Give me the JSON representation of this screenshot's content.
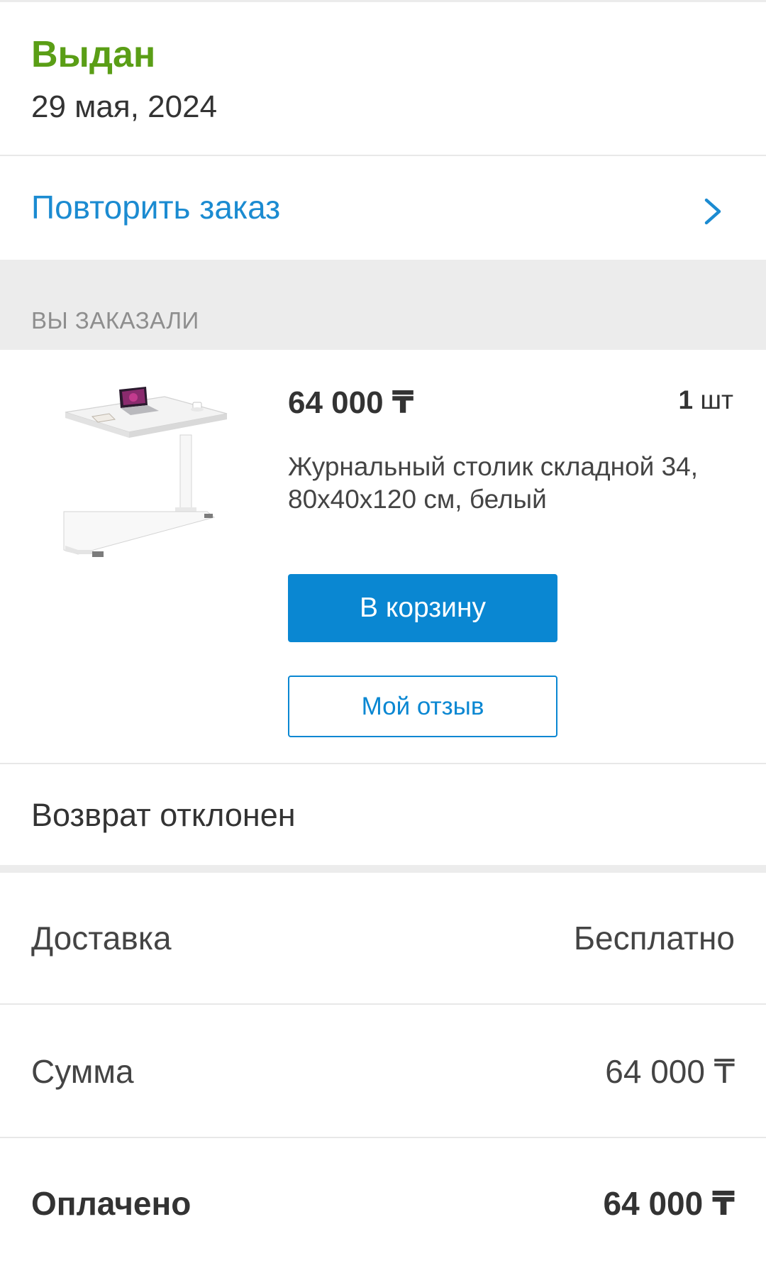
{
  "order": {
    "status": "Выдан",
    "date": "29 мая, 2024",
    "status_color": "#5a9e16"
  },
  "repeat": {
    "label": "Повторить заказ",
    "icon": "chevron-right-icon"
  },
  "section": {
    "title": "ВЫ ЗАКАЗАЛИ"
  },
  "product": {
    "price": "64 000 ₸",
    "qty_number": "1",
    "qty_unit": "шт",
    "name": "Журнальный столик складной 34, 80x40x120 см, белый",
    "cart_button": "В корзину",
    "review_button": "Мой отзыв"
  },
  "return_status": "Возврат отклонен",
  "summary": {
    "delivery_label": "Доставка",
    "delivery_value": "Бесплатно",
    "sum_label": "Сумма",
    "sum_value": "64 000 ₸",
    "paid_label": "Оплачено",
    "paid_value": "64 000 ₸"
  },
  "colors": {
    "accent": "#0a87d2",
    "link": "#1b8bd1",
    "section_bg": "#ececec"
  }
}
